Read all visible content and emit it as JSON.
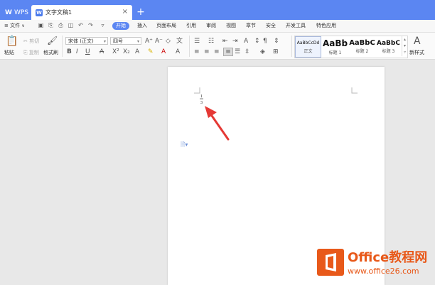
{
  "titlebar": {
    "app_label": "WPS",
    "doc_tab_label": "文字文稿1",
    "close_glyph": "×",
    "new_tab_glyph": "+"
  },
  "menubar": {
    "file_label": "文件",
    "tabs": [
      "开始",
      "插入",
      "页面布局",
      "引用",
      "审阅",
      "视图",
      "章节",
      "安全",
      "开发工具",
      "特色应用"
    ]
  },
  "ribbon": {
    "paste_label": "粘贴",
    "cut_label": "剪切",
    "copy_label": "复制",
    "format_painter_label": "格式刷",
    "font_name": "宋体 (正文)",
    "font_size": "四号",
    "styles": [
      {
        "preview": "AaBbCcDd",
        "label": "正文"
      },
      {
        "preview": "AaBb",
        "label": "标题 1"
      },
      {
        "preview": "AaBbC",
        "label": "标题 2"
      },
      {
        "preview": "AaBbC",
        "label": "标题 3"
      }
    ],
    "new_style_label": "新样式"
  },
  "document": {
    "fraction_numerator": "1",
    "fraction_denominator": "3"
  },
  "watermark": {
    "title": "Office教程网",
    "url": "www.office26.com"
  },
  "colors": {
    "accent": "#5b86f2",
    "arrow": "#e53935",
    "logo": "#e8591a"
  }
}
